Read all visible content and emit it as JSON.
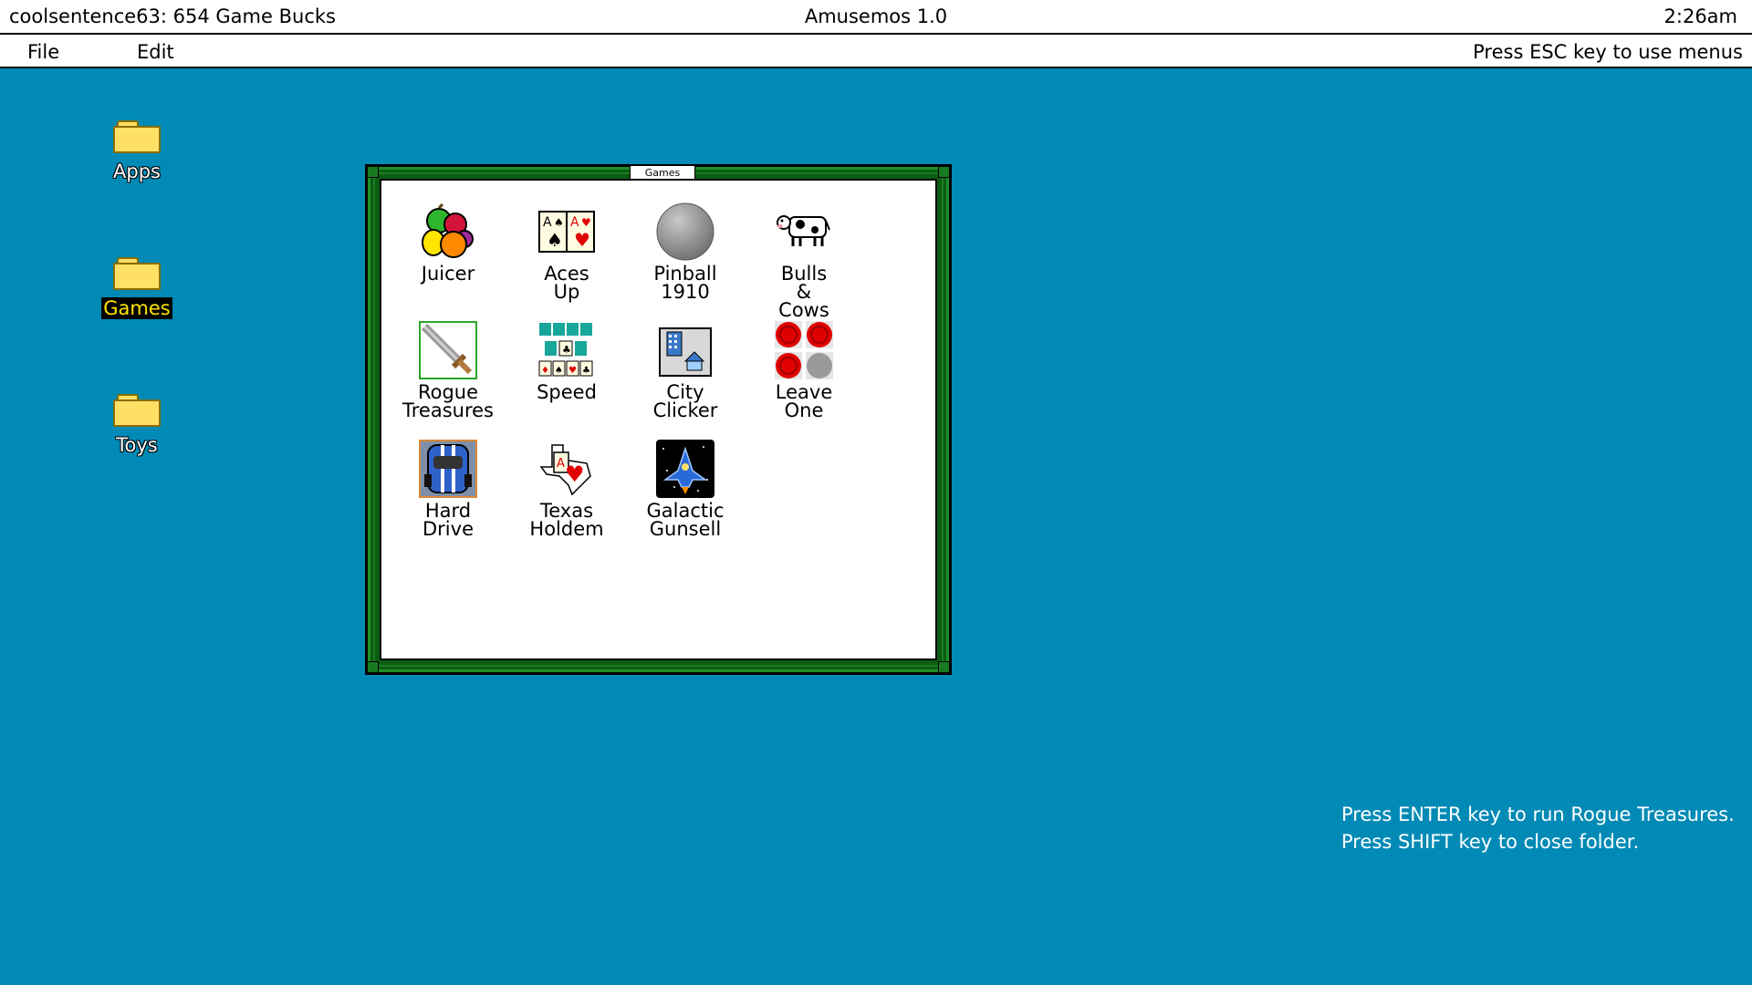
{
  "titlebar": {
    "user_status": "coolsentence63: 654 Game Bucks",
    "app_title": "Amusemos 1.0",
    "clock": "2:26am"
  },
  "menubar": {
    "file": "File",
    "edit": "Edit",
    "hint": "Press ESC key to use menus"
  },
  "desktop": {
    "folders": [
      {
        "label": "Apps"
      },
      {
        "label": "Games"
      },
      {
        "label": "Toys"
      }
    ]
  },
  "window": {
    "title": "Games",
    "games": [
      {
        "label": "Juicer",
        "icon": "fruit-icon"
      },
      {
        "label": "Aces\nUp",
        "icon": "cards-icon"
      },
      {
        "label": "Pinball\n1910",
        "icon": "ball-icon"
      },
      {
        "label": "Bulls\n&\nCows",
        "icon": "cow-icon"
      },
      {
        "label": "Rogue\nTreasures",
        "icon": "sword-icon"
      },
      {
        "label": "Speed",
        "icon": "card-rows-icon"
      },
      {
        "label": "City\nClicker",
        "icon": "city-icon"
      },
      {
        "label": "Leave\nOne",
        "icon": "checkers-icon"
      },
      {
        "label": "Hard\nDrive",
        "icon": "car-icon"
      },
      {
        "label": "Texas\nHoldem",
        "icon": "texas-card-icon"
      },
      {
        "label": "Galactic\nGunsell",
        "icon": "spaceship-icon"
      }
    ]
  },
  "status_hint": {
    "line1": "Press ENTER key to run Rogue Treasures.",
    "line2": "Press SHIFT key to close folder."
  },
  "colors": {
    "desktop": "#008ab5",
    "window_frame": "#0b5d12",
    "folder": "#ffe066",
    "selection_text": "#ffe400"
  }
}
